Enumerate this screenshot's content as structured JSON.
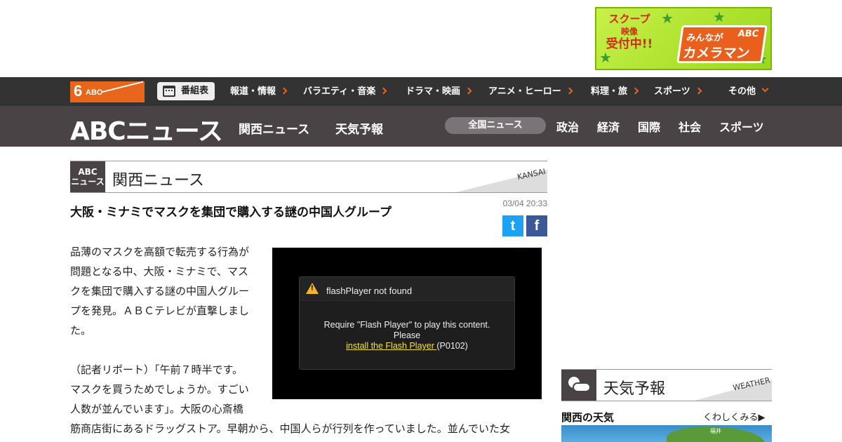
{
  "ad_banner": {
    "scoop_line1": "スクープ",
    "scoop_line2": "映像",
    "scoop_line3": "受付中!!",
    "brand_abc": "ABC",
    "brand_minna": "みんなが",
    "brand_camera": "カメラマン"
  },
  "global_nav": {
    "logo_six": "6",
    "logo_abc": "ABC",
    "program_guide": "番組表",
    "items": [
      {
        "label": "報道・情報"
      },
      {
        "label": "バラエティ・音楽"
      },
      {
        "label": "ドラマ・映画"
      },
      {
        "label": "アニメ・ヒーロー"
      },
      {
        "label": "料理・旅"
      },
      {
        "label": "スポーツ"
      },
      {
        "label": "その他"
      }
    ]
  },
  "news_header": {
    "logo": "ABCニュース",
    "tabs": [
      {
        "label": "関西ニュース"
      },
      {
        "label": "天気予報"
      }
    ],
    "nationwide": "全国ニュース",
    "categories": [
      {
        "label": "政治"
      },
      {
        "label": "経済"
      },
      {
        "label": "国際"
      },
      {
        "label": "社会"
      },
      {
        "label": "スポーツ"
      }
    ]
  },
  "section": {
    "badge_line1": "ABC",
    "badge_line2": "ニュース",
    "title": "関西ニュース",
    "english": "KANSAI"
  },
  "article": {
    "title": "大阪・ミナミでマスクを集団で購入する謎の中国人グループ",
    "time": "03/04 20:33",
    "share_twitter": "t",
    "share_facebook": "f",
    "para1_lines": [
      "品薄のマスクを高額で転売する行為が",
      "問題となる中、大阪・ミナミで、マス",
      "クを集団で購入する謎の中国人グルー",
      "プを発見。ＡＢＣテレビが直撃しまし",
      "た。"
    ],
    "para2_lines": [
      "（記者リポート）「午前７時半です。",
      "マスクを買うためでしょうか。すごい",
      "人数が並んでいます」。大阪の心斎橋"
    ],
    "para2_full_line": "筋商店街にあるドラッグストア。早朝から、中国人らが行列を作っていました。並んでいた女"
  },
  "video": {
    "dialog_title": "flashPlayer not found",
    "message_line1": "Require \"Flash Player\" to play this content.",
    "message_line2": "Please",
    "install_link": "install the Flash Player ",
    "error_code": "(P0102)"
  },
  "sidebar": {
    "weather_title": "天気予報",
    "weather_english": "WEATHER",
    "kansai_weather": "関西の天気",
    "more_link": "くわしくみる▶",
    "map_city": "福井"
  }
}
